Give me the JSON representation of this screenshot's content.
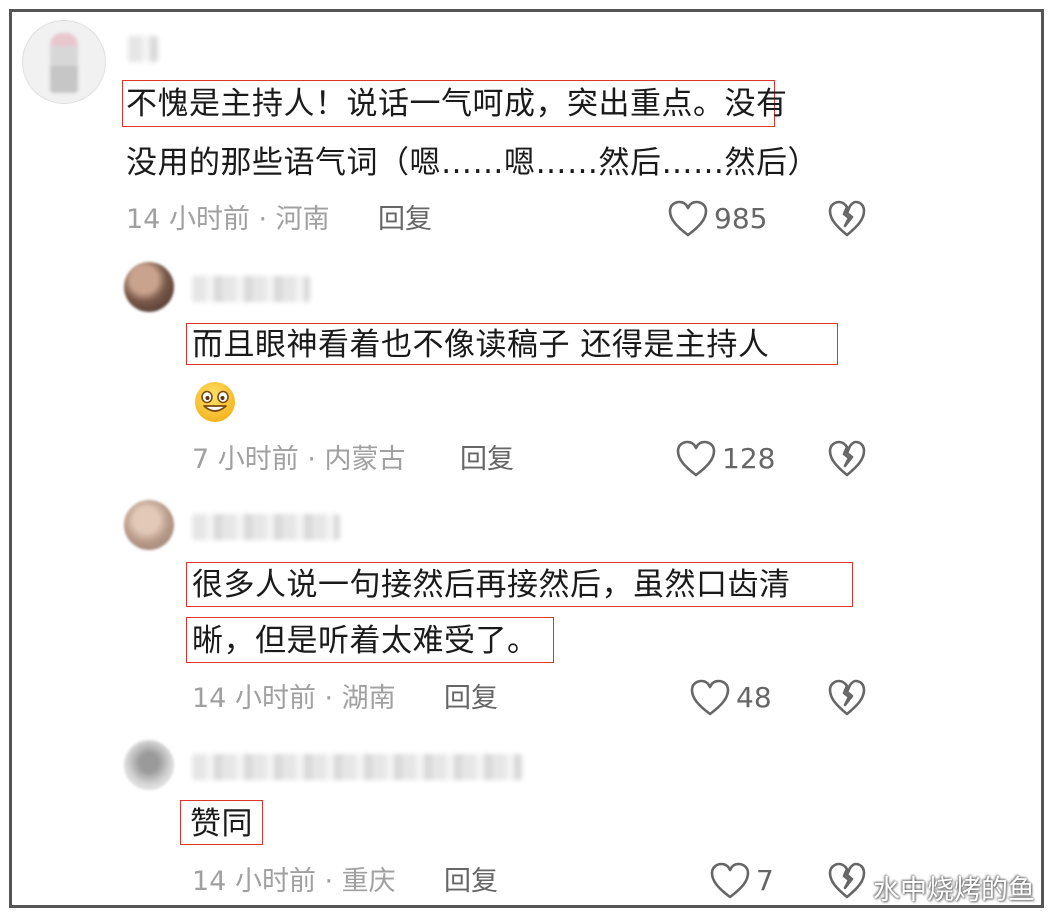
{
  "comments": [
    {
      "lines": [
        "不愧是主持人！说话一气呵成，突出重点。没有",
        "没用的那些语气词（嗯……嗯……然后……然后）"
      ],
      "meta": "14 小时前 · 河南",
      "reply": "回复",
      "likes": "985"
    },
    {
      "lines": [
        "而且眼神看着也不像读稿子  还得是主持人"
      ],
      "emoji": "grinning-face-icon",
      "meta": "7 小时前 · 内蒙古",
      "reply": "回复",
      "likes": "128"
    },
    {
      "lines": [
        "很多人说一句接然后再接然后，虽然口齿清",
        "晰，但是听着太难受了。"
      ],
      "meta": "14 小时前 · 湖南",
      "reply": "回复",
      "likes": "48"
    },
    {
      "lines": [
        "赞同"
      ],
      "meta": "14 小时前 · 重庆",
      "reply": "回复",
      "likes": "7"
    }
  ],
  "icons": {
    "like": "heart-outline-icon",
    "dislike": "broken-heart-icon"
  },
  "colors": {
    "highlight": "#e0352b",
    "meta": "#a0a0a0",
    "text": "#1a1a1a"
  },
  "watermark": "水中烧烤的鱼"
}
